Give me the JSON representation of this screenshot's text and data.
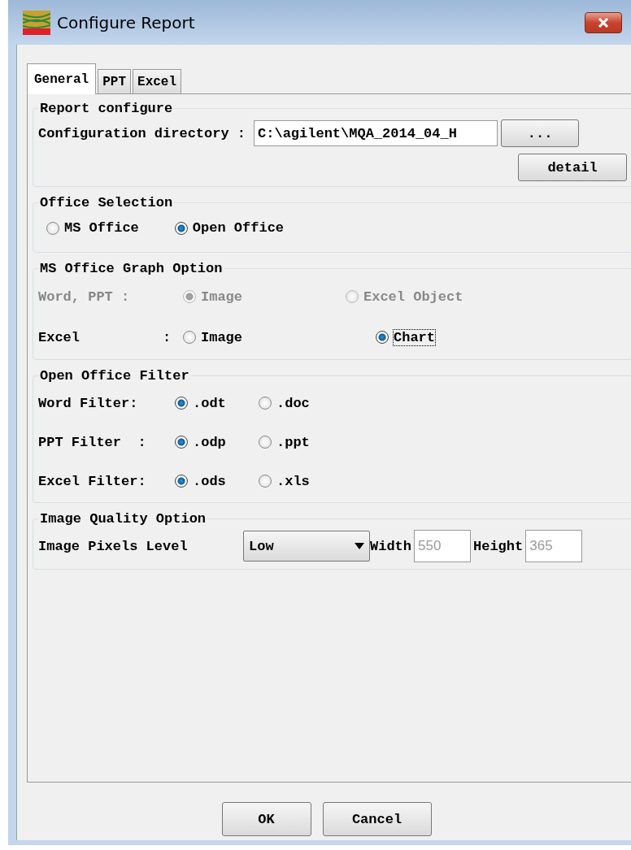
{
  "window": {
    "title": "Configure Report"
  },
  "tabs": [
    {
      "label": "General",
      "selected": true
    },
    {
      "label": "PPT",
      "selected": false
    },
    {
      "label": "Excel",
      "selected": false
    }
  ],
  "report_configure": {
    "title": "Report configure",
    "directory_label": "Configuration directory :",
    "directory_value": "C:\\agilent\\MQA_2014_04_H",
    "browse_button": "...",
    "detail_button": "detail"
  },
  "office_selection": {
    "title": "Office Selection",
    "options": [
      {
        "label": "MS Office",
        "selected": false
      },
      {
        "label": "Open Office",
        "selected": true
      }
    ]
  },
  "graph_option": {
    "title": "MS Office Graph Option",
    "rows": [
      {
        "label": "Word, PPT :",
        "disabled": true,
        "options": [
          {
            "label": "Image",
            "selected": true,
            "focused": false
          },
          {
            "label": "Excel Object",
            "selected": false,
            "focused": false
          }
        ]
      },
      {
        "label": "Excel          :",
        "disabled": false,
        "options": [
          {
            "label": "Image",
            "selected": false,
            "focused": false
          },
          {
            "label": "Chart",
            "selected": true,
            "focused": true
          }
        ]
      }
    ]
  },
  "filter": {
    "title": "Open Office Filter",
    "rows": [
      {
        "label": "Word Filter: ",
        "options": [
          {
            "label": ".odt",
            "selected": true
          },
          {
            "label": ".doc",
            "selected": false
          }
        ]
      },
      {
        "label": "PPT Filter  :",
        "options": [
          {
            "label": ".odp",
            "selected": true
          },
          {
            "label": ".ppt",
            "selected": false
          }
        ]
      },
      {
        "label": "Excel Filter:",
        "options": [
          {
            "label": ".ods",
            "selected": true
          },
          {
            "label": ".xls",
            "selected": false
          }
        ]
      }
    ]
  },
  "image_quality": {
    "title": "Image Quality Option",
    "level_label": "Image Pixels Level",
    "level_value": "Low",
    "width_label": "Width",
    "width_value": "550",
    "height_label": "Height",
    "height_value": "365"
  },
  "buttons": [
    "OK",
    "Cancel"
  ]
}
